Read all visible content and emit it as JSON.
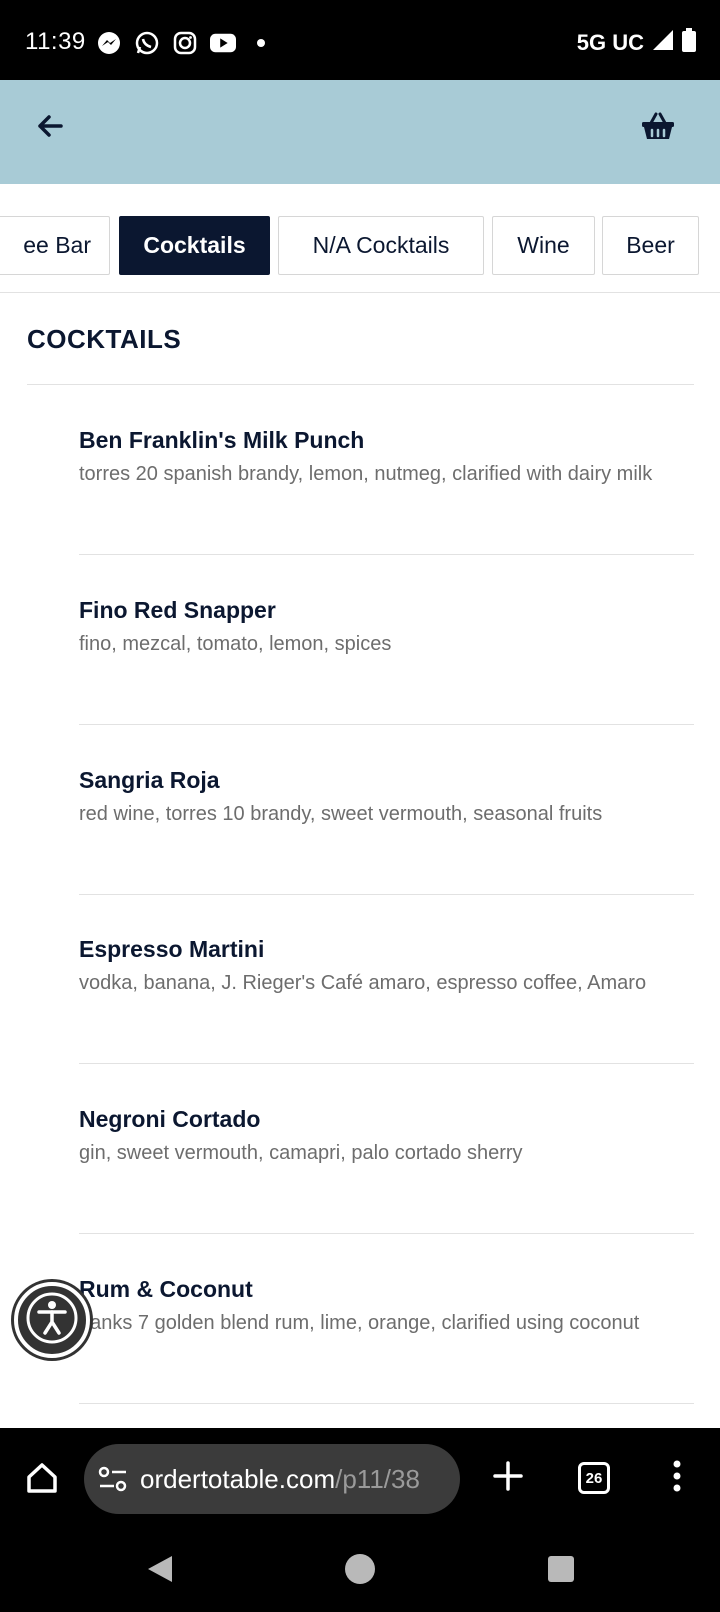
{
  "status_bar": {
    "time": "11:39",
    "network": "5G UC",
    "notification_icons": [
      "messenger-icon",
      "whatsapp-icon",
      "instagram-icon",
      "youtube-icon",
      "dot-icon"
    ]
  },
  "header": {
    "back_icon": "arrow-left-icon",
    "basket_icon": "basket-icon",
    "background_color": "#a8cbd6"
  },
  "tabs": [
    {
      "label": "ee Bar",
      "active": false
    },
    {
      "label": "Cocktails",
      "active": true
    },
    {
      "label": "N/A Cocktails",
      "active": false
    },
    {
      "label": "Wine",
      "active": false
    },
    {
      "label": "Beer",
      "active": false
    }
  ],
  "section": {
    "title": "COCKTAILS"
  },
  "items": [
    {
      "name": "Ben Franklin's Milk Punch",
      "description": "torres 20 spanish brandy, lemon, nutmeg, clarified with dairy milk"
    },
    {
      "name": "Fino Red Snapper",
      "description": "fino, mezcal, tomato, lemon, spices"
    },
    {
      "name": "Sangria Roja",
      "description": "red wine, torres 10 brandy, sweet vermouth, seasonal fruits"
    },
    {
      "name": "Espresso Martini",
      "description": "vodka, banana, J. Rieger's Café amaro, espresso coffee, Amaro"
    },
    {
      "name": "Negroni Cortado",
      "description": "gin, sweet vermouth, camapri, palo cortado sherry"
    },
    {
      "name": "Rum & Coconut",
      "description": "banks 7 golden blend rum, lime, orange, clarified using coconut"
    }
  ],
  "browser": {
    "url_domain": "ordertotable.com",
    "url_path": "/p11/38",
    "tab_count": "26"
  },
  "colors": {
    "primary": "#0b1730",
    "header_bg": "#a8cbd6"
  }
}
